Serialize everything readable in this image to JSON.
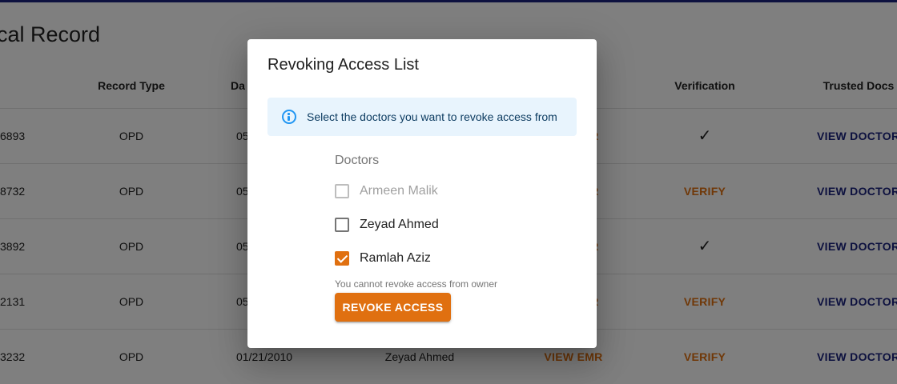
{
  "page": {
    "title": "cal Record"
  },
  "table": {
    "headers": {
      "record_type": "Record Type",
      "date": "Da",
      "verification": "Verification",
      "trusted_docs": "Trusted Docs"
    },
    "rows": [
      {
        "id": "6893",
        "record_type": "OPD",
        "date": "05",
        "emr": "R",
        "verification": "✓",
        "trusted": "VIEW DOCTORS"
      },
      {
        "id": "8732",
        "record_type": "OPD",
        "date": "05",
        "emr": "R",
        "verification": "VERIFY",
        "trusted": "VIEW DOCTORS"
      },
      {
        "id": "3892",
        "record_type": "OPD",
        "date": "05",
        "emr": "R",
        "verification": "✓",
        "trusted": "VIEW DOCTORS"
      },
      {
        "id": "2131",
        "record_type": "OPD",
        "date": "05",
        "emr": "R",
        "verification": "VERIFY",
        "trusted": "VIEW DOCTORS"
      },
      {
        "id": "3232",
        "record_type": "OPD",
        "date": "01/21/2010",
        "doctor": "Zeyad Ahmed",
        "emr": "VIEW EMR",
        "verification": "VERIFY",
        "trusted": "VIEW DOCTORS"
      }
    ]
  },
  "dialog": {
    "title": "Revoking Access List",
    "alert_icon": "info-icon",
    "alert_text": "Select the doctors you want to revoke access from",
    "group_label": "Doctors",
    "options": [
      {
        "label": "Armeen Malik",
        "checked": false,
        "disabled": true
      },
      {
        "label": "Zeyad Ahmed",
        "checked": false,
        "disabled": false
      },
      {
        "label": "Ramlah Aziz",
        "checked": true,
        "disabled": false
      }
    ],
    "helper_text": "You cannot revoke access from owner",
    "revoke_button": "REVOKE ACCESS"
  },
  "colors": {
    "accent": "#e07010",
    "navy": "#1a237e",
    "info": "#2196f3",
    "info_bg": "#e8f4fd"
  }
}
